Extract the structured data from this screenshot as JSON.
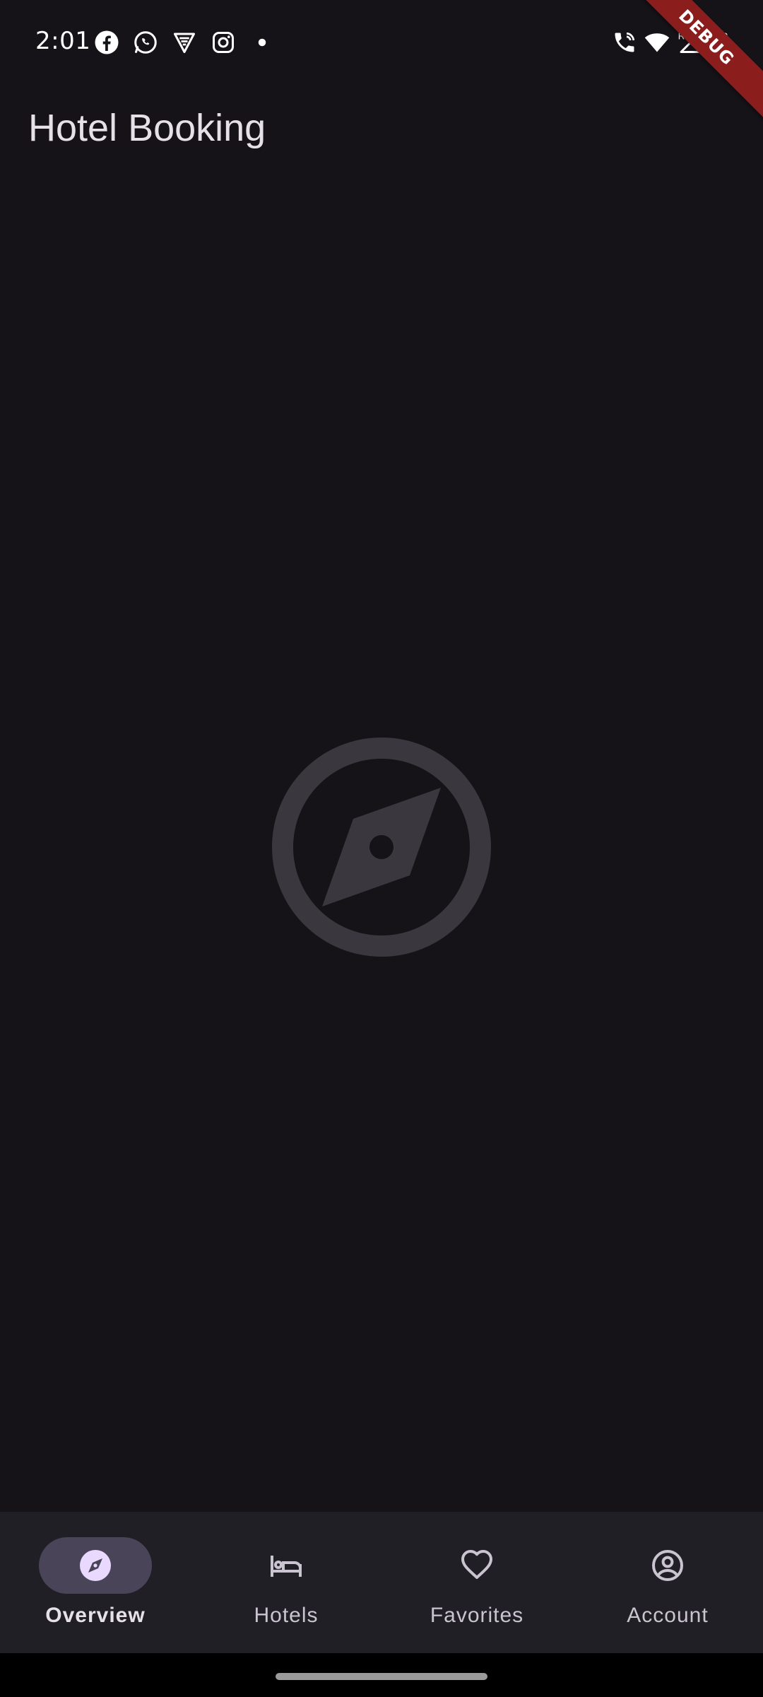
{
  "status_bar": {
    "time": "2:01",
    "left_icons": [
      "facebook-icon",
      "whatsapp-icon",
      "vpn-shield-icon",
      "instagram-icon",
      "notification-dot-icon"
    ],
    "right_icons": [
      "wifi-calling-icon",
      "wifi-icon",
      "roaming-signal-icon",
      "battery-icon"
    ],
    "roaming_label": "R"
  },
  "debug_banner": {
    "label": "DEBUG",
    "color": "#8b1d1d"
  },
  "app_bar": {
    "title": "Hotel Booking"
  },
  "main": {
    "center_icon": "compass-icon",
    "center_icon_color": "#3a373e"
  },
  "bottom_nav": {
    "selected_index": 0,
    "items": [
      {
        "label": "Overview",
        "icon": "compass-icon",
        "active": true
      },
      {
        "label": "Hotels",
        "icon": "bed-icon",
        "active": false
      },
      {
        "label": "Favorites",
        "icon": "heart-outline-icon",
        "active": false
      },
      {
        "label": "Account",
        "icon": "account-circle-icon",
        "active": false
      }
    ]
  },
  "colors": {
    "background": "#151218",
    "nav_background": "#211f26",
    "nav_indicator": "#4a4458",
    "text_primary": "#e6e0e9",
    "text_secondary": "#cac4d0",
    "active_icon": "#ead9ff"
  }
}
